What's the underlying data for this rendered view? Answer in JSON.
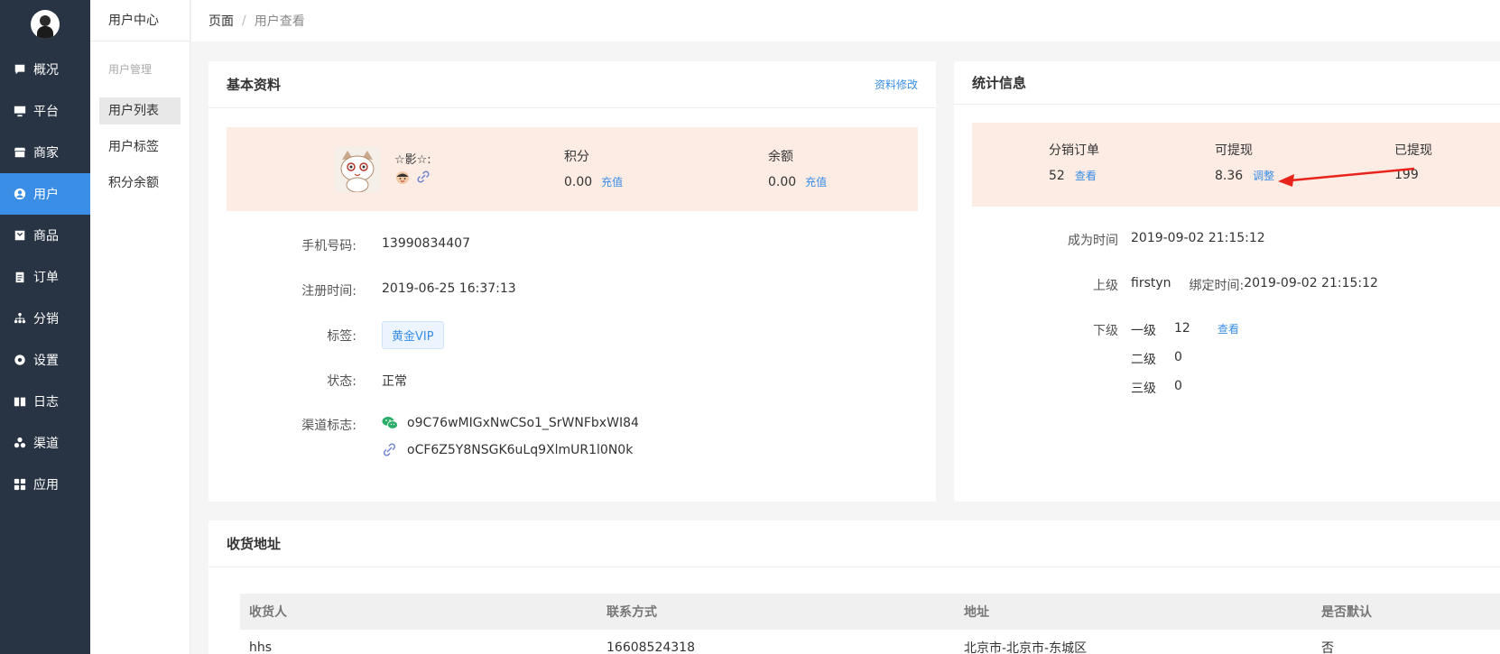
{
  "sidebar": {
    "items": [
      {
        "label": "概况",
        "icon": "chat-icon"
      },
      {
        "label": "平台",
        "icon": "monitor-icon"
      },
      {
        "label": "商家",
        "icon": "store-icon"
      },
      {
        "label": "用户",
        "icon": "user-icon"
      },
      {
        "label": "商品",
        "icon": "bag-icon"
      },
      {
        "label": "订单",
        "icon": "clipboard-icon"
      },
      {
        "label": "分销",
        "icon": "org-icon"
      },
      {
        "label": "设置",
        "icon": "gear-icon"
      },
      {
        "label": "日志",
        "icon": "book-icon"
      },
      {
        "label": "渠道",
        "icon": "cluster-icon"
      },
      {
        "label": "应用",
        "icon": "grid-icon"
      }
    ],
    "active_index": 3
  },
  "subnav": {
    "title": "用户中心",
    "group": "用户管理",
    "items": [
      "用户列表",
      "用户标签",
      "积分余额"
    ]
  },
  "breadcrumb": {
    "root": "页面",
    "separator": "/",
    "current": "用户查看"
  },
  "basic": {
    "title": "基本资料",
    "edit_link": "资料修改",
    "nickname": "☆影☆:",
    "points_label": "积分",
    "points_value": "0.00",
    "points_action": "充值",
    "balance_label": "余额",
    "balance_value": "0.00",
    "balance_action": "充值",
    "phone_label": "手机号码:",
    "phone_value": "13990834407",
    "reg_label": "注册时间:",
    "reg_value": "2019-06-25 16:37:13",
    "tag_label": "标签:",
    "tag_value": "黄金VIP",
    "status_label": "状态:",
    "status_value": "正常",
    "channel_label": "渠道标志:",
    "channel_wechat": "o9C76wMIGxNwCSo1_SrWNFbxWI84",
    "channel_link": "oCF6Z5Y8NSGK6uLq9XlmUR1l0N0k"
  },
  "stats": {
    "title": "统计信息",
    "orders_label": "分销订单",
    "orders_value": "52",
    "orders_action": "查看",
    "withdrawable_label": "可提现",
    "withdrawable_value": "8.36",
    "withdrawable_action": "调整",
    "withdrawn_label": "已提现",
    "withdrawn_value": "199",
    "became_label": "成为时间",
    "became_value": "2019-09-02 21:15:12",
    "parent_label": "上级",
    "parent_value": "firstyn",
    "bind_label": "绑定时间:",
    "bind_value": "2019-09-02 21:15:12",
    "children_label": "下级",
    "level1_label": "一级",
    "level1_value": "12",
    "level1_action": "查看",
    "level2_label": "二级",
    "level2_value": "0",
    "level3_label": "三级",
    "level3_value": "0"
  },
  "address": {
    "title": "收货地址",
    "columns": [
      "收货人",
      "联系方式",
      "地址",
      "是否默认"
    ],
    "rows": [
      [
        "hhs",
        "16608524318",
        "北京市-北京市-东城区",
        "否"
      ]
    ]
  },
  "colors": {
    "sidebar_bg": "#283443",
    "accent": "#3a8ee6",
    "pink": "#fdece4",
    "arrow": "#e8231b"
  }
}
